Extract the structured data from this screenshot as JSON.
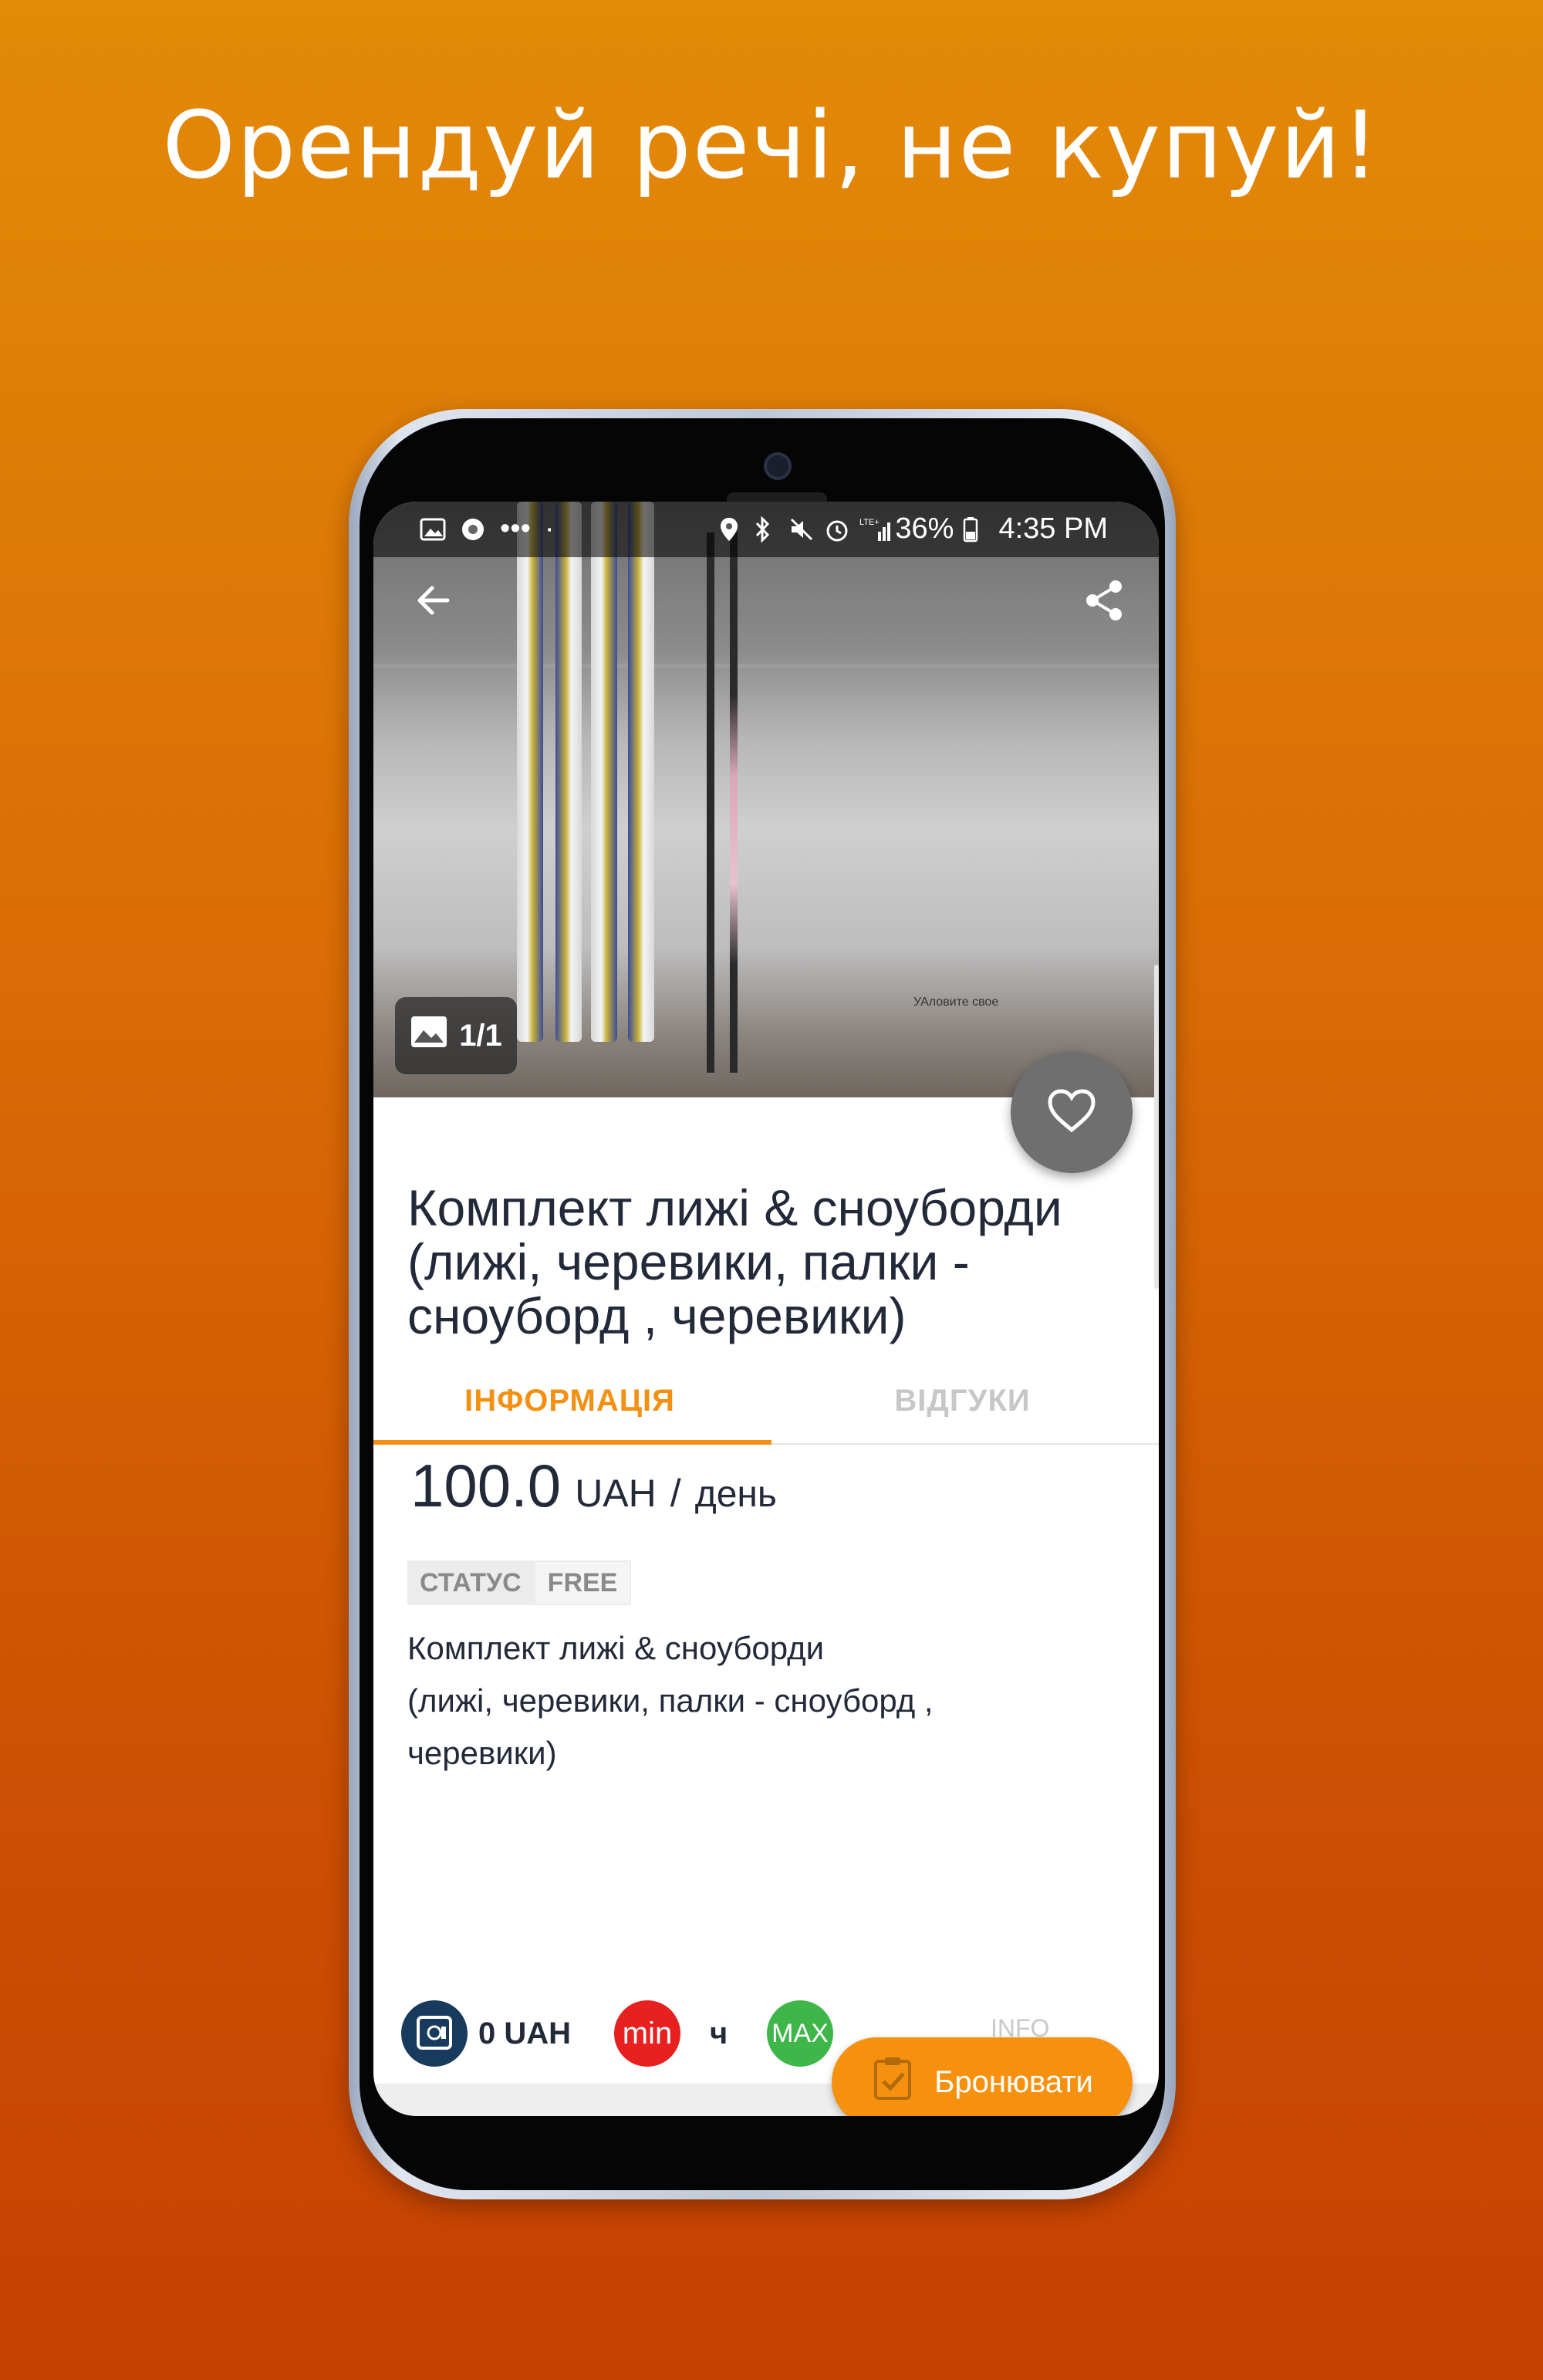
{
  "headline": "Орендуй речі, не купуй!",
  "statusbar": {
    "battery": "36%",
    "time": "4:35 PM"
  },
  "hero": {
    "counter": "1/1",
    "watermark": "УАловите свое"
  },
  "product": {
    "title": "Комплект лижі & сноуборди (лижі, черевики, палки - сноуборд , черевики)",
    "description": "Комплект лижі & сноуборди\n(лижі, черевики, палки - сноуборд ,\nчеревики)"
  },
  "tabs": [
    {
      "label": "ІНФОРМАЦІЯ",
      "active": true
    },
    {
      "label": "ВІДГУКИ",
      "active": false
    }
  ],
  "price": {
    "amount": "100.0",
    "currency": "UAH",
    "slash": "/",
    "unit": "день"
  },
  "status": {
    "key": "СТАТУС",
    "value": "FREE"
  },
  "bottom_bar": {
    "deposit": "0 UAH",
    "min_label": "min",
    "min_value": "ч",
    "max_label": "MAX",
    "info_faded": "INFO"
  },
  "book_button": {
    "label": "Бронювати"
  },
  "colors": {
    "accent": "#f39012",
    "dark_text": "#222a3a",
    "min_red": "#e8201f",
    "max_green": "#3fb649",
    "deposit_navy": "#183a5c"
  },
  "icons": [
    "back-arrow-icon",
    "share-icon",
    "image-icon",
    "heart-icon",
    "safe-icon",
    "clipboard-check-icon"
  ]
}
